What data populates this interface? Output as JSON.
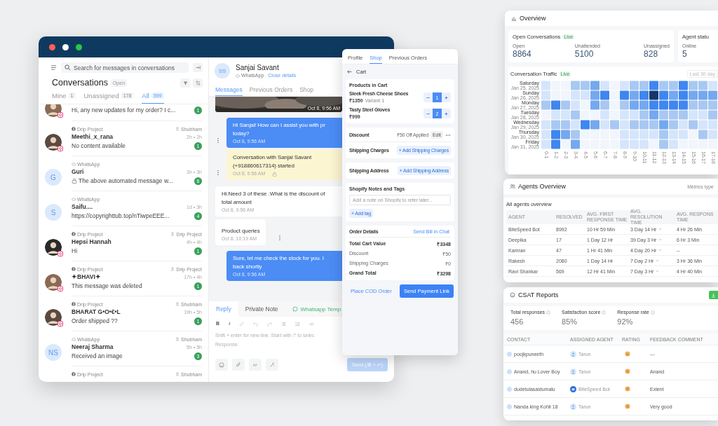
{
  "conversation_list": {
    "search": {
      "placeholder": "Search for messages in conversations"
    },
    "title": "Conversations",
    "status": "Open",
    "tabs": [
      {
        "label": "Mine",
        "count": "1",
        "selected": false
      },
      {
        "label": "Unassigned",
        "count": "178",
        "selected": false
      },
      {
        "label": "All",
        "count": "599",
        "selected": true
      }
    ],
    "items": [
      {
        "automated": false,
        "preview": "Hi, any new updates for my order? I c...",
        "unread": "1"
      },
      {
        "source": {
          "kind": "facebook",
          "label": "Drip Project"
        },
        "assignee": "Shubham",
        "name": "Meethi_x_rana",
        "time": "2h • 2h",
        "automated": false,
        "preview": "No content available",
        "unread": "1"
      },
      {
        "source": {
          "kind": "whatsapp",
          "label": "WhatsApp"
        },
        "avatar": {
          "kind": "initials",
          "initials": "G"
        },
        "name": "Guri",
        "time": "3h • 3h",
        "automated": true,
        "preview": "The above automated message w...",
        "unread": "6"
      },
      {
        "source": {
          "kind": "whatsapp",
          "label": "WhatsApp"
        },
        "avatar": {
          "kind": "initials",
          "initials": "S"
        },
        "name": "Saifu....",
        "time": "1d • 3h",
        "automated": false,
        "preview": "https://copyrighttub.top/nTiwpeEEE...",
        "unread": "4"
      },
      {
        "source": {
          "kind": "facebook",
          "label": "Drip Project"
        },
        "assignee": "Drip Project",
        "name": "Hepsi Hannah",
        "time": "4h • 4h",
        "automated": false,
        "preview": "Hi",
        "unread": "1"
      },
      {
        "source": {
          "kind": "facebook",
          "label": "Drip Project"
        },
        "assignee": "Drip Project",
        "name": "✦BHAVI✦",
        "time": "17h • 4h",
        "automated": false,
        "preview": "This message was deleted",
        "unread": "1"
      },
      {
        "source": {
          "kind": "facebook",
          "label": "Drip Project"
        },
        "assignee": "Shubham",
        "name": "BHARAT G•O•€•L",
        "time": "19h • 5h",
        "automated": false,
        "preview": "Order shipped ??",
        "unread": "1"
      },
      {
        "source": {
          "kind": "whatsapp",
          "label": "WhatsApp"
        },
        "assignee": "Shubham",
        "avatar": {
          "kind": "initials",
          "initials": "NS"
        },
        "name": "Neeraj Sharma",
        "time": "5h • 5h",
        "automated": false,
        "preview": "Received an image",
        "unread": "3"
      },
      {
        "source": {
          "kind": "facebook",
          "label": "Drip Project"
        },
        "assignee": "Shubham"
      }
    ]
  },
  "chat": {
    "contact": {
      "initials": "SS",
      "name": "Sanjai Savant",
      "channel": "WhatsApp",
      "link": "Close details"
    },
    "tabs": [
      {
        "label": "Messages",
        "selected": true
      },
      {
        "label": "Previous Orders",
        "selected": false
      },
      {
        "label": "Shop",
        "selected": false
      }
    ],
    "messages": [
      {
        "time": "Oct 8, 9:56 AM",
        "menu": false
      },
      {
        "kind": "outgoing",
        "lines": [
          "Hi Sanjai! How can I assist you with pr",
          "today?"
        ],
        "time": "Oct 8, 9:56 AM",
        "menu": true
      },
      {
        "kind": "system",
        "lines": [
          "Conversation with Sanjai Savant",
          "(+918860617314) started"
        ],
        "time": "Oct 8, 9:56 AM",
        "menu": true
      },
      {
        "kind": "incoming",
        "lines": [
          "Hi.Need 3 of these .What is the discount of",
          "total amount"
        ],
        "time": "Oct 8, 9:56 AM",
        "menu": false
      },
      {
        "kind": "incoming",
        "lines": [
          "Product queries"
        ],
        "time": "Oct 8, 10:19 AM",
        "menu": true
      },
      {
        "kind": "outgoing",
        "lines": [
          "Sure, let me check the stock for you. I",
          "back shortly"
        ],
        "time": "Oct 8, 9:56 AM",
        "menu": false
      }
    ],
    "composer": {
      "tabs": [
        {
          "label": "Reply",
          "kind": "text",
          "selected": true
        },
        {
          "label": "Private Note",
          "kind": "text",
          "selected": false
        },
        {
          "label": "Whatsapp Temp",
          "kind": "whatsapp",
          "selected": false
        }
      ],
      "format_buttons": [
        "B",
        "I"
      ],
      "placeholder": "Shift + enter for new line. Start with '/' to selec\nResponse.",
      "send": {
        "label": "Send (⌘ + ↵)",
        "disabled": true
      }
    }
  },
  "shop_panel": {
    "tabs": [
      {
        "label": "Profile",
        "selected": false
      },
      {
        "label": "Shop",
        "selected": true
      },
      {
        "label": "Previous Orders",
        "selected": false
      }
    ],
    "back_label": "Cart",
    "cart": {
      "title": "Products in Cart",
      "products": [
        {
          "name": "Sleek Fresh Cheese Shoes",
          "price": "₹1350",
          "variant": "Variant 1",
          "quantity": "1"
        },
        {
          "name": "Tasty Steel Gloves",
          "price": "₹999",
          "quantity": "2"
        }
      ]
    },
    "discount": {
      "label": "Discount",
      "value": "₹50 Off Applied",
      "action": "Edit"
    },
    "shipping_charges": {
      "label": "Shipping Charges",
      "action": "+ Add Shipping Charges"
    },
    "shipping_address": {
      "label": "Shipping Address",
      "action": "+ Add Shipping Address"
    },
    "notes": {
      "title": "Shopify Notes and Tags",
      "placeholder": "Add a note on Shopify to refer later...",
      "action": "+ Add tag"
    },
    "order_details": {
      "title": "Order Details",
      "action": "Send Bill in Chat",
      "rows": [
        {
          "label": "Total Cart Value",
          "value": "₹3348",
          "bold": true
        },
        {
          "label": "Discount",
          "value": "₹50",
          "bold": false
        },
        {
          "label": "Shipping Charges",
          "value": "₹0",
          "bold": false
        },
        {
          "label": "Grand Total",
          "value": "₹3298",
          "bold": true
        }
      ]
    },
    "footer": {
      "secondary": "Place COD Order",
      "primary": "Send Payment Link"
    }
  },
  "overview": {
    "title": "Overview",
    "open_conversations": {
      "title": "Open Conversations",
      "badge": "Live",
      "stats": [
        {
          "label": "Open",
          "value": "8864"
        },
        {
          "label": "Unattended",
          "value": "5100"
        },
        {
          "label": "Unassigned",
          "value": "828"
        }
      ]
    },
    "agent_status": {
      "title": "Agent statu",
      "stats": [
        {
          "label": "Online",
          "value": "5"
        }
      ]
    },
    "traffic": {
      "title": "Conversation Traffic",
      "badge": "Live",
      "range": "Last 30 day",
      "days": [
        {
          "day": "Saturday",
          "date": "Jan 25, 2025"
        },
        {
          "day": "Sunday",
          "date": "Jan 26, 2025"
        },
        {
          "day": "Monday",
          "date": "Jan 27, 2025"
        },
        {
          "day": "Tuesday",
          "date": "Jan 28, 2025"
        },
        {
          "day": "Wednesday",
          "date": "Jan 29, 2025"
        },
        {
          "day": "Thursday",
          "date": "Jan 30, 2025"
        },
        {
          "day": "Friday",
          "date": "Jan 31, 2025"
        }
      ],
      "hours": [
        "0-1",
        "1-2",
        "2-3",
        "3-4",
        "4-5",
        "5-6",
        "6-7",
        "7-8",
        "8-9",
        "9-10",
        "10-11",
        "11-12",
        "12-13",
        "13-14",
        "14-15",
        "15-16",
        "16-17",
        "17-18"
      ]
    }
  },
  "agents_overview": {
    "title": "Agents Overview",
    "metrics_label": "Metrics type",
    "subtitle": "All agents overview",
    "columns": [
      "AGENT",
      "RESOLVED",
      "AVG. FIRST RESPONSE TIME",
      "AVG. RESOLUTION TIME",
      "AVG. RESPONS TIME"
    ],
    "rows": [
      [
        "BiteSpeed Bot",
        "8992",
        "10 Hr 59 Min",
        "3 Day 14 Hr",
        "4 Hr 26 Min"
      ],
      [
        "Deepika",
        "17",
        "1 Day 12 Hr",
        "39 Day 3 Hr",
        "6 Hr 3 Min"
      ],
      [
        "Kamran",
        "47",
        "1 Hr 41 Min",
        "4 Day 20 Hr",
        "--"
      ],
      [
        "Rakesh",
        "2080",
        "1 Day 14 Hr",
        "7 Day 2 Hr",
        "3 Hr 36 Min"
      ],
      [
        "Ravi Shankar",
        "569",
        "12 Hr 41 Min",
        "7 Day 3 Hr",
        "4 Hr 40 Min"
      ]
    ]
  },
  "csat_reports": {
    "title": "CSAT Reports",
    "stats": [
      {
        "label": "Total responses",
        "value": "456"
      },
      {
        "label": "Satisfaction score",
        "value": "85%"
      },
      {
        "label": "Response rate",
        "value": "92%"
      }
    ],
    "columns": [
      "CONTACT",
      "ASSIGNED AGENT",
      "RATING",
      "FEEDBACK COMMENT"
    ],
    "rows": [
      {
        "contact": "poojkpuneeth",
        "agent": {
          "name": "Tarun",
          "kind": "human"
        },
        "rating": {
          "kind": "neutral"
        },
        "comment": "---"
      },
      {
        "contact": "Anand, hu Lover Boy",
        "agent": {
          "name": "Tarun",
          "kind": "human"
        },
        "rating": {
          "kind": "love"
        },
        "comment": "Anand"
      },
      {
        "contact": "dudetulasaidumalu",
        "agent": {
          "name": "BiteSpeed Bot",
          "kind": "bot"
        },
        "rating": {
          "kind": "love"
        },
        "comment": "Exlent"
      },
      {
        "contact": "Nanda king Kohli 18",
        "agent": {
          "name": "Tarun",
          "kind": "human"
        },
        "rating": {
          "kind": "love"
        },
        "comment": "Very good"
      }
    ]
  }
}
